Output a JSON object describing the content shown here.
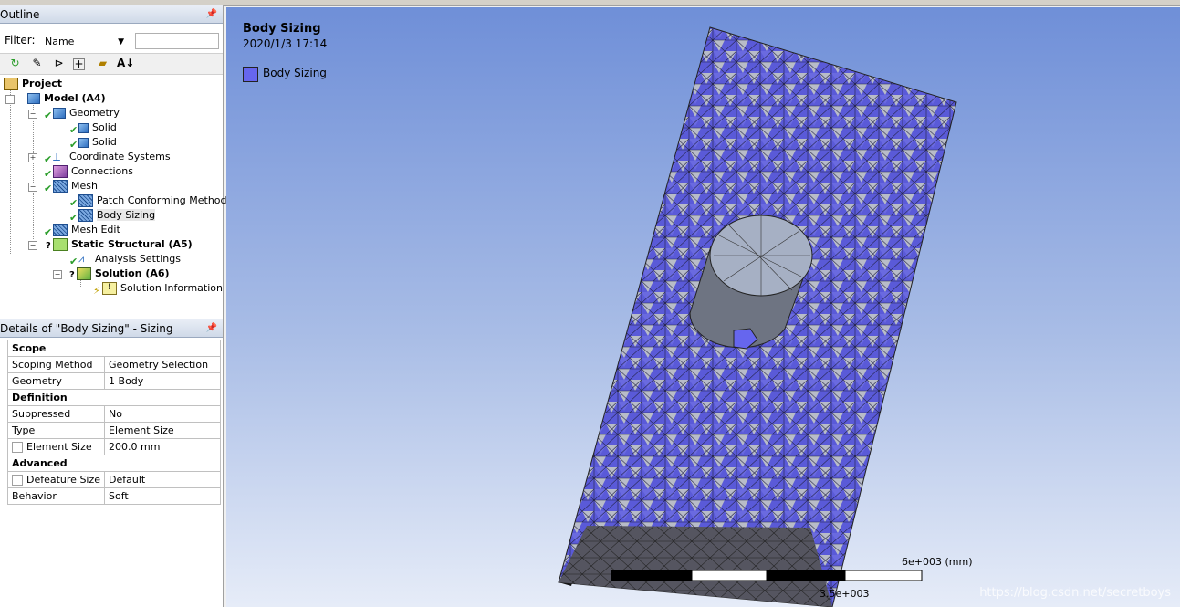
{
  "outline": {
    "title": "Outline",
    "filter_label": "Filter:",
    "filter_value": "Name",
    "tree": [
      {
        "label": "Project",
        "bold": true
      },
      {
        "label": "Model (A4)",
        "bold": true
      },
      {
        "label": "Geometry"
      },
      {
        "label": "Solid"
      },
      {
        "label": "Solid"
      },
      {
        "label": "Coordinate Systems"
      },
      {
        "label": "Connections"
      },
      {
        "label": "Mesh"
      },
      {
        "label": "Patch Conforming Method"
      },
      {
        "label": "Body Sizing",
        "selected": true
      },
      {
        "label": "Mesh Edit"
      },
      {
        "label": "Static Structural (A5)",
        "bold": true
      },
      {
        "label": "Analysis Settings"
      },
      {
        "label": "Solution (A6)",
        "bold": true
      },
      {
        "label": "Solution Information"
      }
    ]
  },
  "details": {
    "title": "Details of \"Body Sizing\" - Sizing",
    "rows": [
      {
        "section": "Scope"
      },
      {
        "key": "Scoping Method",
        "value": "Geometry Selection"
      },
      {
        "key": "Geometry",
        "value": "1 Body"
      },
      {
        "section": "Definition"
      },
      {
        "key": "Suppressed",
        "value": "No"
      },
      {
        "key": "Type",
        "value": "Element Size"
      },
      {
        "key": "Element Size",
        "value": "200.0 mm",
        "checkbox": true
      },
      {
        "section": "Advanced"
      },
      {
        "key": "Defeature Size",
        "value": "Default",
        "checkbox": true
      },
      {
        "key": "Behavior",
        "value": "Soft"
      }
    ]
  },
  "viewport": {
    "title": "Body Sizing",
    "date": "2020/1/3 17:14",
    "legend_label": "Body Sizing",
    "legend_color": "#6666ee",
    "scale_top": "6e+003 (mm)",
    "scale_bottom": "3.5e+003",
    "watermark": "https://blog.csdn.net/secretboys"
  },
  "colors": {
    "mesh_blue": "#5a5ad8",
    "mesh_grey": "#b8bcc8",
    "background_top": "#6f8fd8"
  }
}
